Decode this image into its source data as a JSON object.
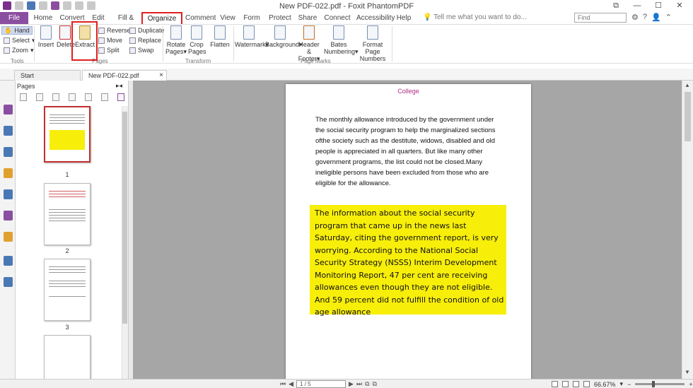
{
  "window": {
    "title": "New PDF-022.pdf - Foxit PhantomPDF"
  },
  "menu": {
    "tabs": [
      "File",
      "Home",
      "Convert",
      "Edit",
      "Fill & Sign",
      "Organize",
      "Comment",
      "View",
      "Form",
      "Protect",
      "Share",
      "Connect",
      "Accessibility",
      "Help"
    ],
    "active_tab": "Organize",
    "tell_me_placeholder": "Tell me what you want to do...",
    "find_placeholder": "Find"
  },
  "ribbon": {
    "tools": {
      "hand": "Hand",
      "select": "Select",
      "zoom": "Zoom",
      "group": "Tools"
    },
    "pages": {
      "insert": "Insert",
      "delete": "Delete",
      "extract": "Extract",
      "reverse": "Reverse",
      "move": "Move",
      "split": "Split",
      "duplicate": "Duplicate",
      "replace": "Replace",
      "swap": "Swap",
      "group": "Pages"
    },
    "transform": {
      "rotate_1": "Rotate",
      "rotate_2": "Pages",
      "crop_1": "Crop",
      "crop_2": "Pages",
      "flatten": "Flatten",
      "group": "Transform"
    },
    "page_marks": {
      "watermark": "Watermark",
      "background": "Background",
      "header_1": "Header &",
      "header_2": "Footer",
      "bates_1": "Bates",
      "bates_2": "Numbering",
      "format_1": "Format Page",
      "format_2": "Numbers",
      "group": "Page Marks"
    }
  },
  "doc_tabs": {
    "start": "Start",
    "current": "New PDF-022.pdf",
    "close": "×"
  },
  "pages_panel": {
    "header": "Pages",
    "thumb_labels": [
      "1",
      "2",
      "3"
    ]
  },
  "document": {
    "heading": "College",
    "paragraph": "The monthly allowance introduced by the government under the social security program to help the marginalized sections ofthe society such as the destitute, widows, disabled and old people is appreciated in all quarters. But like many other government programs, the list could not be closed.Many ineligible persons have been excluded from those who are eligible for the allowance.",
    "highlighted": "The information about the social security program that came up in the news last Saturday, citing the government report, is very worrying. According to the National Social Security Strategy (NSSS) Interim Development Monitoring Report, 47 per cent are receiving allowances even though they are not eligible. And 59 percent did not fulfill the condition of old age allowance"
  },
  "status": {
    "page_indicator": "1 / 5",
    "zoom": "66.67%"
  },
  "colors": {
    "accent": "#8a4ea0",
    "annotation_red": "#e02020",
    "highlight": "#f7ee0a",
    "heading_pink": "#b03088"
  }
}
